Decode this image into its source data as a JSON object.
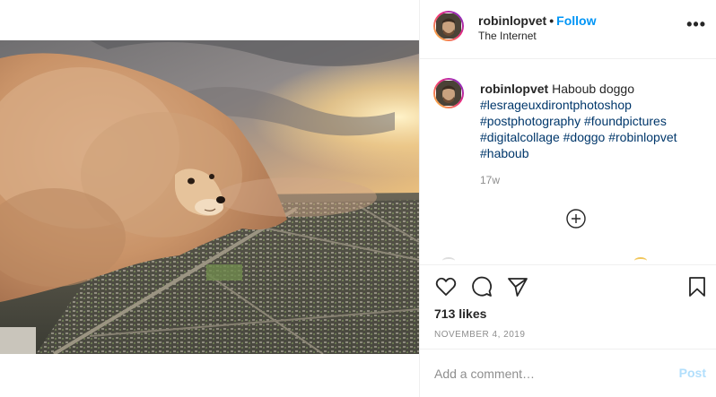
{
  "post": {
    "username": "robinlopvet",
    "separator": "•",
    "follow_label": "Follow",
    "location": "The Internet",
    "more_icon": "more-options-icon",
    "more_glyph": "•••"
  },
  "caption": {
    "username": "robinlopvet",
    "text": "Haboub doggo",
    "hashtags": [
      "#lesrageuxdirontphotoshop",
      "#postphotography",
      "#foundpictures",
      "#digitalcollage",
      "#doggo",
      "#robinlopvet",
      "#haboub"
    ],
    "time_ago": "17w"
  },
  "actions": {
    "icons": [
      "heart-icon",
      "comment-icon",
      "share-icon",
      "bookmark-icon"
    ],
    "likes": "713 likes",
    "date": "November 4, 2019"
  },
  "comment_box": {
    "placeholder": "Add a comment…",
    "post_label": "Post"
  },
  "colors": {
    "accent": "#0095f6",
    "link": "#00376b",
    "muted": "#8e8e8e",
    "post_disabled": "#b2dffc",
    "border": "#efefef"
  },
  "media": {
    "subject": "doge-shaped dust storm over city"
  }
}
